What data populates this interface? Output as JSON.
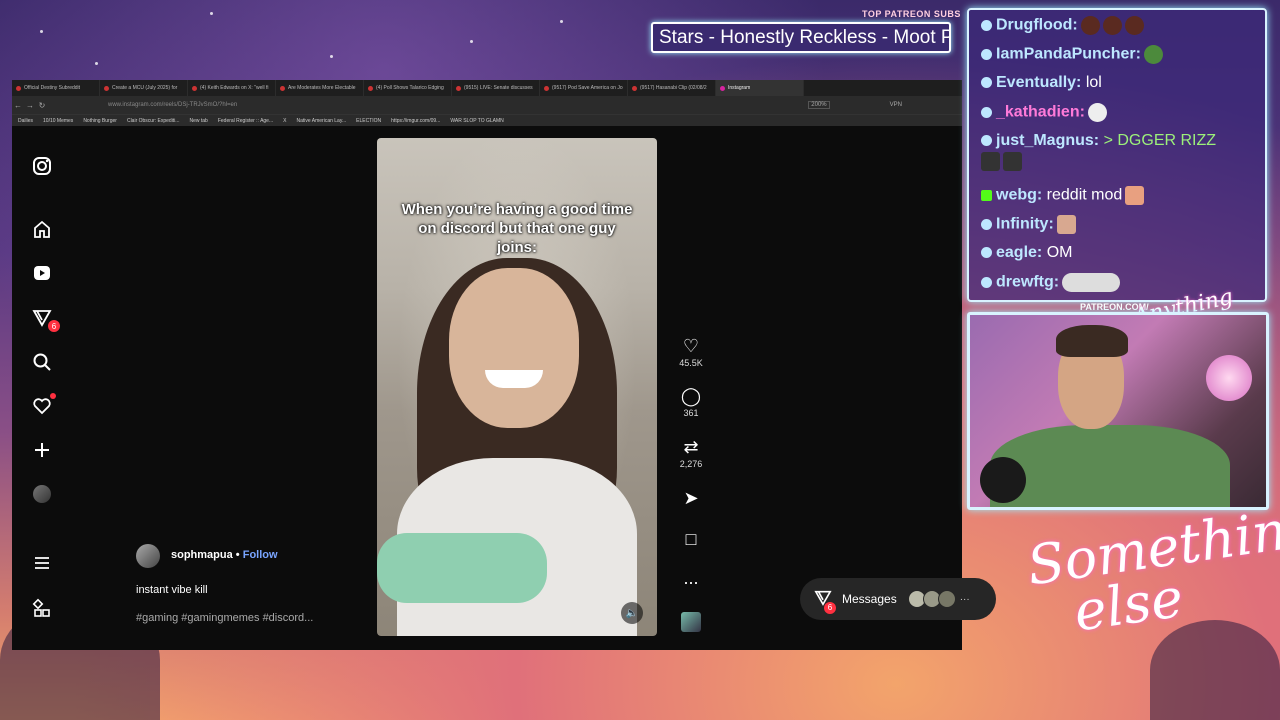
{
  "overlay": {
    "patreon_subs_label": "TOP PATREON SUBS",
    "ticker_text": "Stars - Honestly Reckless - Moot P",
    "patreon_url": "PATREON.COM/",
    "signature_line1": "Something",
    "signature_line2": "else",
    "anything_else": "Anything else?"
  },
  "browser": {
    "tabs": [
      {
        "label": "Official Destiny Subreddit"
      },
      {
        "label": "Create a MCU (July 2025) for"
      },
      {
        "label": "(4) Keith Edwards on X: \"well fi"
      },
      {
        "label": "Are Moderates More Electable"
      },
      {
        "label": "(4) Poll Shows Talarico Edging"
      },
      {
        "label": "(9515) LIVE: Senate discusses"
      },
      {
        "label": "(9517) Pod Save America on Jo"
      },
      {
        "label": "(9517) Hasanabi Clip (02/08/2"
      },
      {
        "label": "Instagram"
      }
    ],
    "url": "www.instagram.com/reels/DSj-TRJvSmO/?hl=en",
    "zoom": "200%",
    "vpn_label": "VPN",
    "bookmarks": [
      "Dailies",
      "10/10 Memes",
      "Nothing Burger",
      "Clair Obscur: Expediti...",
      "New tab",
      "",
      "Federal Register :: Age...",
      "X",
      "Native American Lay...",
      "ELECTION",
      "https://imgur.com/09...",
      "WAR SLOP TO GLAMN"
    ]
  },
  "instagram": {
    "sidebar": {
      "messages_badge": "6"
    },
    "video": {
      "caption": "When you’re having a good time on discord but that one guy joins:"
    },
    "actions": {
      "likes": "45.5K",
      "comments": "361",
      "reposts": "2,276",
      "more": "..."
    },
    "post": {
      "username": "sophmapua",
      "separator": "•",
      "follow": "Follow",
      "text": "instant vibe kill",
      "tags": "#gaming #gamingmemes #discord..."
    },
    "messages": {
      "label": "Messages",
      "badge": "6",
      "more": "···"
    }
  },
  "chat": {
    "messages": [
      {
        "user": "Drugflood:",
        "text": ""
      },
      {
        "user": "IamPandaPuncher:",
        "text": ""
      },
      {
        "user": "Eventually:",
        "text": "lol"
      },
      {
        "user": "_kathadien:",
        "text": ""
      },
      {
        "user": "just_Magnus:",
        "text": "> DGGER RIZZ"
      },
      {
        "user": "webg:",
        "text": "reddit mod"
      },
      {
        "user": "Infinity:",
        "text": ""
      },
      {
        "user": "eagle:",
        "text": "OM"
      },
      {
        "user": "drewftg:",
        "text": ""
      }
    ]
  },
  "colors": {
    "chat_user": "#bde7ff",
    "follow": "#7aa5ff",
    "badge_red": "#ff3040"
  }
}
